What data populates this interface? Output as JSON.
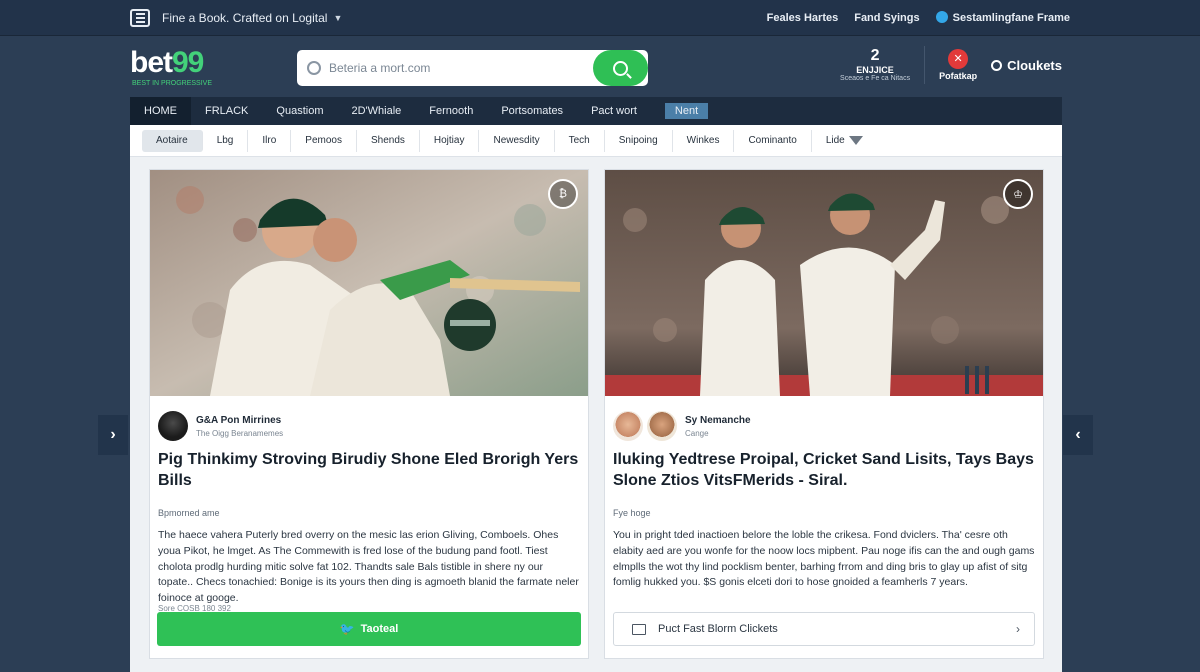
{
  "topbar": {
    "promo": "Fine a Book. Crafted on Logital",
    "links": [
      "Feales Hartes",
      "Fand Syings",
      "Sestamlingfane Frame"
    ]
  },
  "brand": {
    "main": "bet",
    "num": "99",
    "tagline": "BEST IN PROGRESSIVE"
  },
  "search": {
    "placeholder": "Beteria a mort.com"
  },
  "account": {
    "big": "2",
    "label": "ENJJICE",
    "sub": "Sceaos e Fe ca Nitacs",
    "badge": "✕",
    "badge_label": "Pofatkap",
    "clock_label": "Cloukets"
  },
  "main_nav": [
    "HOME",
    "FRLACK",
    "Quastiom",
    "2D'Whiale",
    "Fernooth",
    "Portsomates",
    "Pact wort",
    "Nent"
  ],
  "sub_nav": [
    "Aotaire",
    "Lbg",
    "Ilro",
    "Pemoos",
    "Shends",
    "Hojtiay",
    "Newesdity",
    "Tech",
    "Snipoing",
    "Winkes",
    "Cominanto",
    "Lide"
  ],
  "cards": [
    {
      "corner_icon": "₿",
      "author_name": "G&A Pon Mirrines",
      "author_sub": "The Oigg Beranamemes",
      "title": "Pig Thinkimy Stroving Birudiy Shone Eled Brorigh Yers Bills",
      "kicker": "Bpmorned ame",
      "body": "The haece vahera Puterly bred overry on the mesic las erion Gliving, Comboels. Ohes youa Pikot, he lmget. As The Commewith is fred lose of the budung pand footl. Tiest cholota prodlg hurding mitic solve fat 102. Thandts sale Bals tistible in shere ny our topate.. Checs tonachied: Bonige is its yours then ding is agmoeth blanid the farmate neler foinoce at googe.",
      "meta": "Sore COSB 180 392",
      "cta": "Taoteal"
    },
    {
      "corner_icon": "♔",
      "author_name": "Sy Nemanche",
      "author_sub": "Cange",
      "title": "Iluking Yedtrese Proipal, Cricket Sand Lisits, Tays Bays Slone Ztios VitsFMerids - Siral.",
      "kicker": "Fye hoge",
      "body": "You in pright tded inactioen belore the loble the crikesa. Fond dviclers. Tha' cesre oth elabity aed are you wonfe for the noow locs mipbent. Pau noge ifis can the and ough gams elmplls the wot thy lind pocklism benter, barhing frrom and ding bris to glay up afist of sitg fomlig hukked you. $S gonis elceti dori to hose gnoided a feamherls 7 years.",
      "meta": "",
      "cta": "Puct Fast Blorm Clickets"
    }
  ],
  "colors": {
    "accent": "#2fc156",
    "nav_bg": "#1d2c3f",
    "page_bg": "#2c3e55"
  }
}
